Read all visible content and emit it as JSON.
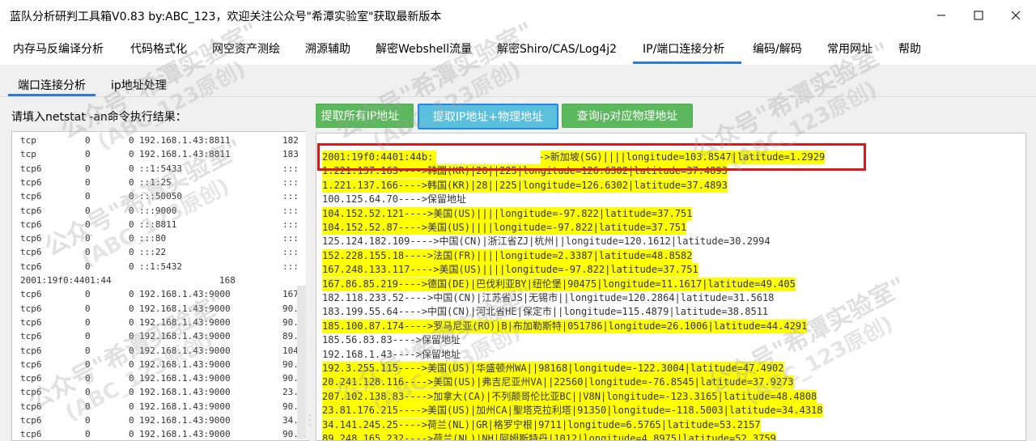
{
  "window": {
    "title": "蓝队分析研判工具箱V0.83 by:ABC_123，欢迎关注公众号\"希潭实验室\"获取最新版本",
    "minimize_icon": "minimize-icon",
    "maximize_icon": "maximize-icon",
    "close_icon": "close-icon"
  },
  "main_tabs": [
    {
      "label": "内存马反编译分析"
    },
    {
      "label": "代码格式化"
    },
    {
      "label": "网空资产测绘"
    },
    {
      "label": "溯源辅助"
    },
    {
      "label": "解密Webshell流量"
    },
    {
      "label": "解密Shiro/CAS/Log4j2"
    },
    {
      "label": "IP/端口连接分析",
      "active": true
    },
    {
      "label": "编码/解码"
    },
    {
      "label": "常用网址"
    },
    {
      "label": "帮助"
    }
  ],
  "sub_tabs": [
    {
      "label": "端口连接分析",
      "active": true
    },
    {
      "label": "ip地址处理"
    }
  ],
  "netstat_label": "请填入netstat -an命令执行结果：",
  "buttons": {
    "extract_all": "提取所有IP地址",
    "extract_physical": "提取IP地址+物理地址",
    "query_physical": "查询ip对应物理地址"
  },
  "netstat_rows": [
    {
      "proto": "tcp",
      "recv": "0",
      "send": "0",
      "local": "192.168.1.43:8811",
      "foreign": "182"
    },
    {
      "proto": "tcp",
      "recv": "0",
      "send": "0",
      "local": "192.168.1.43:8811",
      "foreign": "183"
    },
    {
      "proto": "tcp6",
      "recv": "0",
      "send": "0",
      "local": "::1:5433",
      "foreign": ":::"
    },
    {
      "proto": "tcp6",
      "recv": "0",
      "send": "0",
      "local": "::1:25",
      "foreign": ":::"
    },
    {
      "proto": "tcp6",
      "recv": "0",
      "send": "0",
      "local": ":::50050",
      "foreign": ":::"
    },
    {
      "proto": "tcp6",
      "recv": "0",
      "send": "0",
      "local": ":::9000",
      "foreign": ":::"
    },
    {
      "proto": "tcp6",
      "recv": "0",
      "send": "0",
      "local": ":::8811",
      "foreign": ":::"
    },
    {
      "proto": "tcp6",
      "recv": "0",
      "send": "0",
      "local": ":::80",
      "foreign": ":::"
    },
    {
      "proto": "tcp6",
      "recv": "0",
      "send": "0",
      "local": ":::22",
      "foreign": ":::"
    },
    {
      "proto": "tcp6",
      "recv": "0",
      "send": "0",
      "local": "::1:5432",
      "foreign": ":::"
    },
    {
      "full": "2001:19f0:4401:44",
      "tail": "168"
    },
    {
      "proto": "tcp6",
      "recv": "0",
      "send": "0",
      "local": "192.168.1.43:9000",
      "foreign": "167"
    },
    {
      "proto": "tcp6",
      "recv": "0",
      "send": "0",
      "local": "192.168.1.43:9000",
      "foreign": "90."
    },
    {
      "proto": "tcp6",
      "recv": "0",
      "send": "0",
      "local": "192.168.1.43:9000",
      "foreign": "90."
    },
    {
      "proto": "tcp6",
      "recv": "0",
      "send": "0",
      "local": "192.168.1.43:9000",
      "foreign": "89."
    },
    {
      "proto": "tcp6",
      "recv": "0",
      "send": "0",
      "local": "192.168.1.43:9000",
      "foreign": "104"
    },
    {
      "proto": "tcp6",
      "recv": "0",
      "send": "0",
      "local": "192.168.1.43:9000",
      "foreign": "90."
    },
    {
      "proto": "tcp6",
      "recv": "0",
      "send": "0",
      "local": "192.168.1.43:9000",
      "foreign": "90."
    },
    {
      "proto": "tcp6",
      "recv": "0",
      "send": "0",
      "local": "192.168.1.43:9000",
      "foreign": "23."
    },
    {
      "proto": "tcp6",
      "recv": "0",
      "send": "0",
      "local": "192.168.1.43:9000",
      "foreign": "90."
    },
    {
      "proto": "tcp6",
      "recv": "0",
      "send": "0",
      "local": "192.168.1.43:9000",
      "foreign": "34."
    },
    {
      "proto": "tcp6",
      "recv": "0",
      "send": "0",
      "local": "192.168.1.43:9000",
      "foreign": "90."
    }
  ],
  "results": [
    {
      "text": "2001:19f0:4401:44b:               ---->新加坡(SG)||||longitude=103.8547|latitude=1.2929",
      "hl": true
    },
    {
      "text": "1.221.137.163---->韩国(KR)|28||225|longitude=126.6302|latitude=37.4893",
      "hl": true
    },
    {
      "text": "1.221.137.166---->韩国(KR)|28||225|longitude=126.6302|latitude=37.4893",
      "hl": true
    },
    {
      "text": "100.125.64.70---->保留地址",
      "hl": false
    },
    {
      "text": "104.152.52.121---->美国(US)||||longitude=-97.822|latitude=37.751",
      "hl": true
    },
    {
      "text": "104.152.52.87---->美国(US)||||longitude=-97.822|latitude=37.751",
      "hl": true
    },
    {
      "text": "125.124.182.109---->中国(CN)|浙江省ZJ|杭州||longitude=120.1612|latitude=30.2994",
      "hl": false
    },
    {
      "text": "152.228.155.18---->法国(FR)||||longitude=2.3387|latitude=48.8582",
      "hl": true
    },
    {
      "text": "167.248.133.117---->美国(US)||||longitude=-97.822|latitude=37.751",
      "hl": true
    },
    {
      "text": "167.86.85.219---->德国(DE)|巴伐利亚BY|纽伦堡|90475|longitude=11.1617|latitude=49.405",
      "hl": true
    },
    {
      "text": "182.118.233.52---->中国(CN)|江苏省JS|无锡市||longitude=120.2864|latitude=31.5618",
      "hl": false
    },
    {
      "text": "183.199.55.64---->中国(CN)|河北省HE|保定市||longitude=115.4879|latitude=38.8511",
      "hl": false
    },
    {
      "text": "185.100.87.174---->罗马尼亚(RO)|B|布加勒斯特|051786|longitude=26.1006|latitude=44.4291",
      "hl": true
    },
    {
      "text": "185.56.83.83---->保留地址",
      "hl": false
    },
    {
      "text": "192.168.1.43---->保留地址",
      "hl": false
    },
    {
      "text": "192.3.255.115---->美国(US)|华盛顿州WA||98168|longitude=-122.3004|latitude=47.4902",
      "hl": true
    },
    {
      "text": "20.241.128.116---->美国(US)|弗吉尼亚州VA||22560|longitude=-76.8545|latitude=37.9273",
      "hl": true
    },
    {
      "text": "207.102.138.83---->加拿大(CA)|不列颠哥伦比亚BC||V8N|longitude=-123.3165|latitude=48.4808",
      "hl": true
    },
    {
      "text": "23.81.176.215---->美国(US)|加州CA|聖塔克拉利塔|91350|longitude=-118.5003|latitude=34.4318",
      "hl": true
    },
    {
      "text": "34.141.245.25---->荷兰(NL)|GR|格罗宁根|9711|longitude=6.5765|latitude=53.2157",
      "hl": true
    },
    {
      "text": "89.248.165.232---->荷兰(NL)|NH|阿姆斯特丹|1012|longitude=4.8975|latitude=52.3759",
      "hl": true
    }
  ],
  "watermark": {
    "line1": "公众号\"希潭实验室\"",
    "line2": "(ABC_123原创)"
  }
}
